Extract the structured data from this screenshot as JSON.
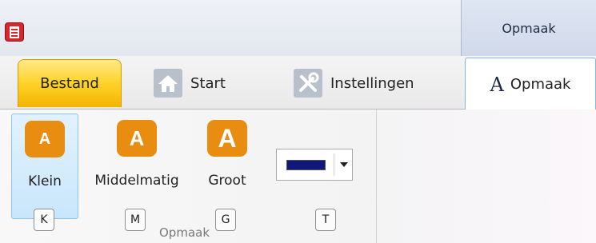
{
  "titlebar": {
    "app_icon": "document-list-icon",
    "context_header": "Opmaak"
  },
  "tabs": {
    "bestand": "Bestand",
    "start": "Start",
    "start_icon": "home-icon",
    "instellingen": "Instellingen",
    "instellingen_icon": "tools-icon",
    "opmaak": "Opmaak",
    "opmaak_glyph": "A"
  },
  "ribbon": {
    "buttons": [
      {
        "label": "Klein",
        "glyph": "A",
        "keytip": "K",
        "selected": true
      },
      {
        "label": "Middelmatig",
        "glyph": "A",
        "keytip": "M",
        "selected": false
      },
      {
        "label": "Groot",
        "glyph": "A",
        "keytip": "G",
        "selected": false
      }
    ],
    "color_picker": {
      "color": "#10197a",
      "keytip": "T",
      "arrow_icon": "dropdown-arrow-icon"
    },
    "group_label": "Opmaak"
  },
  "colors": {
    "accent_orange": "#e88d10",
    "bestand_yellow": "#ffd52e",
    "app_red": "#d8262e"
  }
}
